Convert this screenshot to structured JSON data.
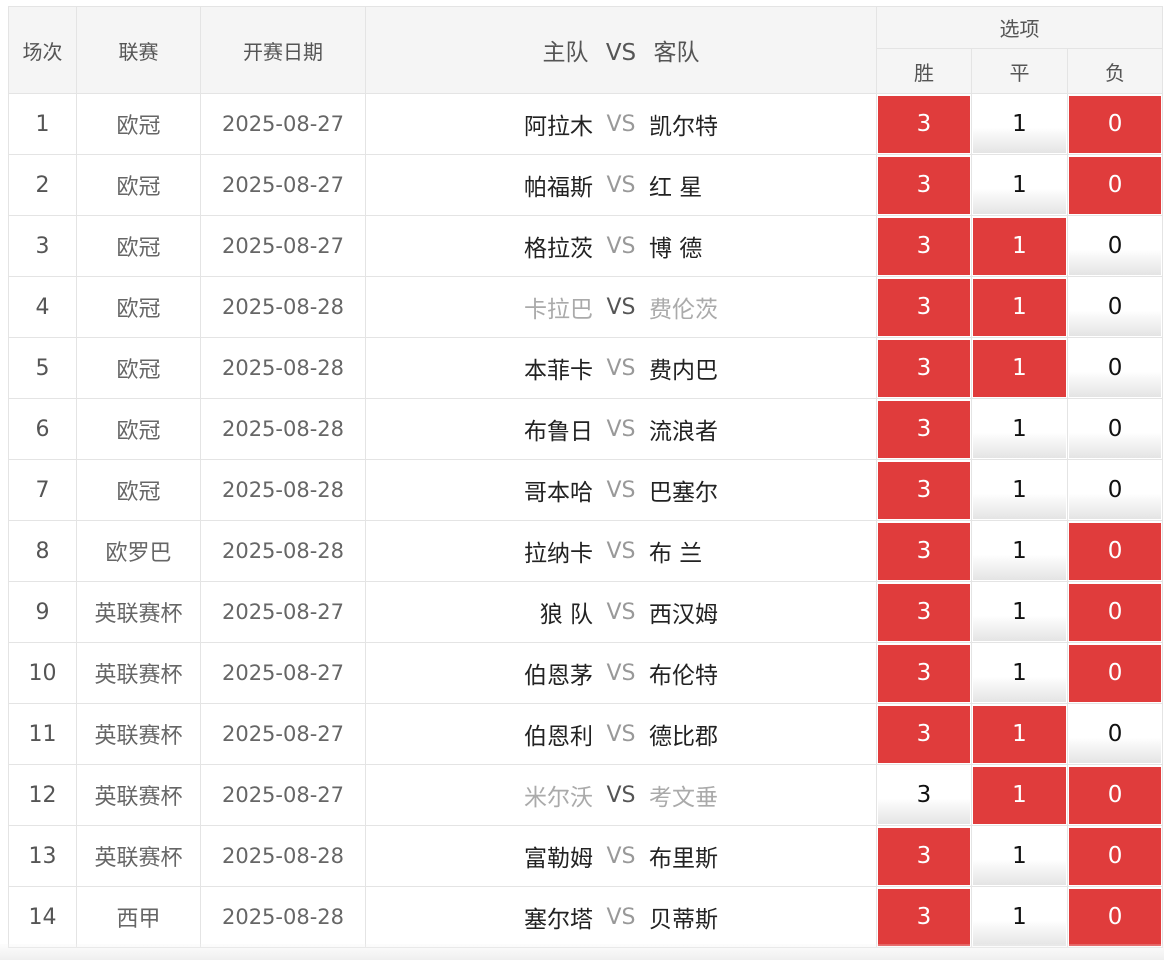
{
  "header": {
    "col_no": "场次",
    "col_league": "联赛",
    "col_date": "开赛日期",
    "col_teams_home": "主队",
    "col_teams_vs": "VS",
    "col_teams_away": "客队",
    "col_options": "选项",
    "opt_win": "胜",
    "opt_draw": "平",
    "opt_loss": "负"
  },
  "colors": {
    "selected": "#e03c3c",
    "border": "#e4e4e4"
  },
  "rows": [
    {
      "no": "1",
      "league": "欧冠",
      "date": "2025-08-27",
      "home": "阿拉木",
      "vs": "VS",
      "away": "凯尔特",
      "muted": false,
      "w": "3",
      "d": "1",
      "l": "0",
      "sel": [
        true,
        false,
        true
      ]
    },
    {
      "no": "2",
      "league": "欧冠",
      "date": "2025-08-27",
      "home": "帕福斯",
      "vs": "VS",
      "away": "红 星",
      "muted": false,
      "w": "3",
      "d": "1",
      "l": "0",
      "sel": [
        true,
        false,
        true
      ]
    },
    {
      "no": "3",
      "league": "欧冠",
      "date": "2025-08-27",
      "home": "格拉茨",
      "vs": "VS",
      "away": "博 德",
      "muted": false,
      "w": "3",
      "d": "1",
      "l": "0",
      "sel": [
        true,
        true,
        false
      ]
    },
    {
      "no": "4",
      "league": "欧冠",
      "date": "2025-08-28",
      "home": "卡拉巴",
      "vs": "VS",
      "away": "费伦茨",
      "muted": true,
      "w": "3",
      "d": "1",
      "l": "0",
      "sel": [
        true,
        true,
        false
      ]
    },
    {
      "no": "5",
      "league": "欧冠",
      "date": "2025-08-28",
      "home": "本菲卡",
      "vs": "VS",
      "away": "费内巴",
      "muted": false,
      "w": "3",
      "d": "1",
      "l": "0",
      "sel": [
        true,
        true,
        false
      ]
    },
    {
      "no": "6",
      "league": "欧冠",
      "date": "2025-08-28",
      "home": "布鲁日",
      "vs": "VS",
      "away": "流浪者",
      "muted": false,
      "w": "3",
      "d": "1",
      "l": "0",
      "sel": [
        true,
        false,
        false
      ]
    },
    {
      "no": "7",
      "league": "欧冠",
      "date": "2025-08-28",
      "home": "哥本哈",
      "vs": "VS",
      "away": "巴塞尔",
      "muted": false,
      "w": "3",
      "d": "1",
      "l": "0",
      "sel": [
        true,
        false,
        false
      ]
    },
    {
      "no": "8",
      "league": "欧罗巴",
      "date": "2025-08-28",
      "home": "拉纳卡",
      "vs": "VS",
      "away": "布 兰",
      "muted": false,
      "w": "3",
      "d": "1",
      "l": "0",
      "sel": [
        true,
        false,
        true
      ]
    },
    {
      "no": "9",
      "league": "英联赛杯",
      "date": "2025-08-27",
      "home": "狼 队",
      "vs": "VS",
      "away": "西汉姆",
      "muted": false,
      "w": "3",
      "d": "1",
      "l": "0",
      "sel": [
        true,
        false,
        true
      ]
    },
    {
      "no": "10",
      "league": "英联赛杯",
      "date": "2025-08-27",
      "home": "伯恩茅",
      "vs": "VS",
      "away": "布伦特",
      "muted": false,
      "w": "3",
      "d": "1",
      "l": "0",
      "sel": [
        true,
        false,
        true
      ]
    },
    {
      "no": "11",
      "league": "英联赛杯",
      "date": "2025-08-27",
      "home": "伯恩利",
      "vs": "VS",
      "away": "德比郡",
      "muted": false,
      "w": "3",
      "d": "1",
      "l": "0",
      "sel": [
        true,
        true,
        false
      ]
    },
    {
      "no": "12",
      "league": "英联赛杯",
      "date": "2025-08-27",
      "home": "米尔沃",
      "vs": "VS",
      "away": "考文垂",
      "muted": true,
      "w": "3",
      "d": "1",
      "l": "0",
      "sel": [
        false,
        true,
        true
      ]
    },
    {
      "no": "13",
      "league": "英联赛杯",
      "date": "2025-08-28",
      "home": "富勒姆",
      "vs": "VS",
      "away": "布里斯",
      "muted": false,
      "w": "3",
      "d": "1",
      "l": "0",
      "sel": [
        true,
        false,
        true
      ]
    },
    {
      "no": "14",
      "league": "西甲",
      "date": "2025-08-28",
      "home": "塞尔塔",
      "vs": "VS",
      "away": "贝蒂斯",
      "muted": false,
      "w": "3",
      "d": "1",
      "l": "0",
      "sel": [
        true,
        false,
        true
      ]
    }
  ]
}
